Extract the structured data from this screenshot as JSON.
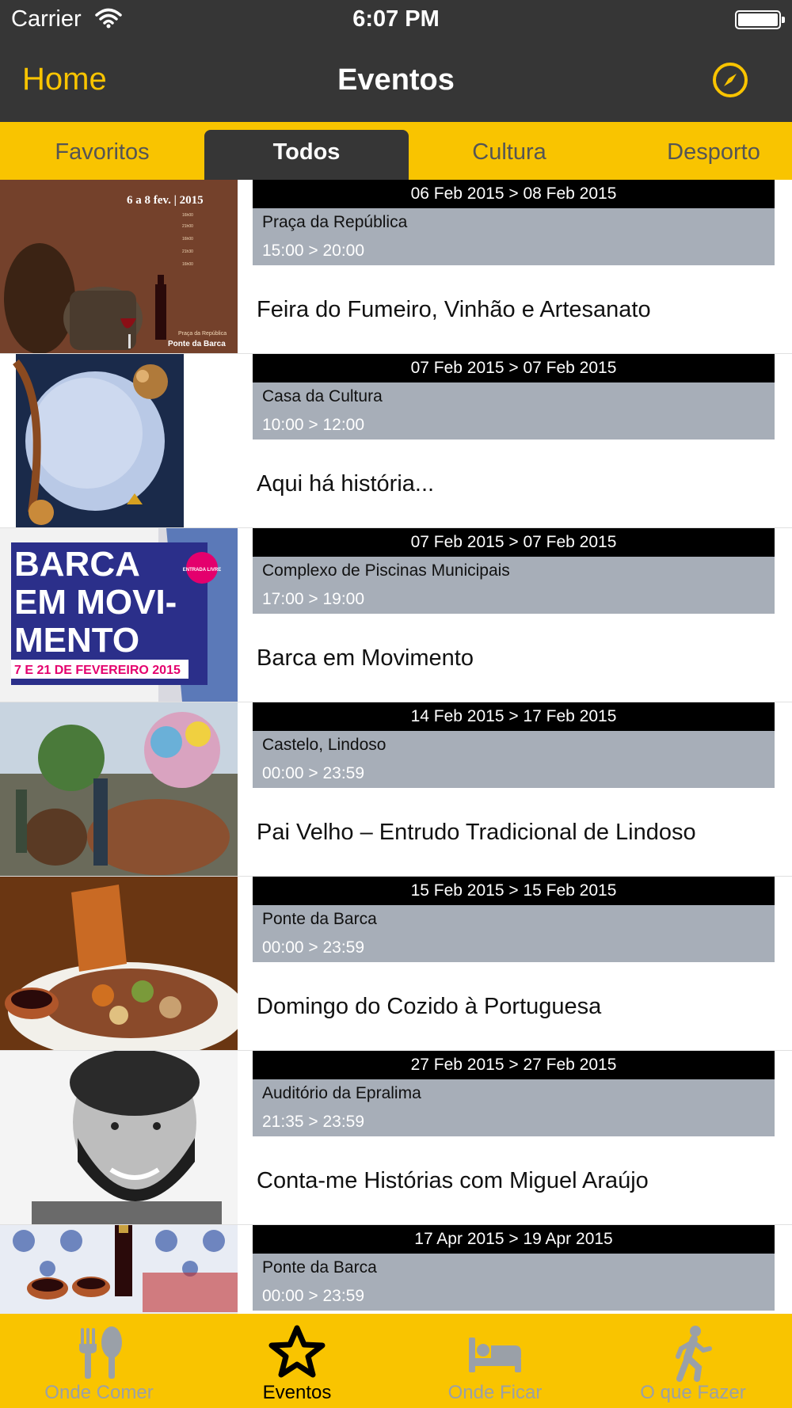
{
  "status_bar": {
    "carrier": "Carrier",
    "time": "6:07 PM"
  },
  "nav": {
    "back_label": "Home",
    "title": "Eventos",
    "right_icon": "compass-icon"
  },
  "segments": [
    {
      "label": "Favoritos",
      "selected": false
    },
    {
      "label": "Todos",
      "selected": true
    },
    {
      "label": "Cultura",
      "selected": false
    },
    {
      "label": "Desporto",
      "selected": false
    }
  ],
  "events": [
    {
      "dates": "06 Feb 2015 > 08 Feb 2015",
      "venue": "Praça da República",
      "time": "15:00 > 20:00",
      "title": "Feira do Fumeiro, Vinhão e Artesanato",
      "poster_text": [
        "6 a 8 fev. | 2015",
        "Praça da República",
        "Ponte da Barca"
      ]
    },
    {
      "dates": "07 Feb 2015 > 07 Feb 2015",
      "venue": "Casa da Cultura",
      "time": "10:00 > 12:00",
      "title": "Aqui há história..."
    },
    {
      "dates": "07 Feb 2015 > 07 Feb 2015",
      "venue": "Complexo de Piscinas Municipais",
      "time": "17:00 > 19:00",
      "title": "Barca em Movimento",
      "poster_text": [
        "BARCA",
        "EM MOVI-",
        "MENTO",
        "7 E 21 DE FEVEREIRO 2015",
        "ENTRADA LIVRE"
      ]
    },
    {
      "dates": "14 Feb 2015 > 17 Feb 2015",
      "venue": "Castelo, Lindoso",
      "time": "00:00 > 23:59",
      "title": "Pai Velho – Entrudo Tradicional de Lindoso"
    },
    {
      "dates": "15 Feb 2015 > 15 Feb 2015",
      "venue": "Ponte da Barca",
      "time": "00:00 > 23:59",
      "title": "Domingo do Cozido à Portuguesa"
    },
    {
      "dates": "27 Feb 2015 > 27 Feb 2015",
      "venue": "Auditório da Epralima",
      "time": "21:35 > 23:59",
      "title": "Conta-me Histórias com Miguel Araújo"
    },
    {
      "dates": "17 Apr 2015 > 19 Apr 2015",
      "venue": "Ponte da Barca",
      "time": "00:00 > 23:59",
      "title": ""
    }
  ],
  "tabs": [
    {
      "label": "Onde Comer",
      "icon": "fork-knife-icon",
      "selected": false
    },
    {
      "label": "Eventos",
      "icon": "star-icon",
      "selected": true
    },
    {
      "label": "Onde Ficar",
      "icon": "bed-icon",
      "selected": false
    },
    {
      "label": "O que Fazer",
      "icon": "walking-person-icon",
      "selected": false
    }
  ],
  "colors": {
    "accent": "#f9c400",
    "bar_dark": "#363636",
    "info_gray": "#a7aeb8",
    "tab_inactive": "#9aa0a8"
  }
}
